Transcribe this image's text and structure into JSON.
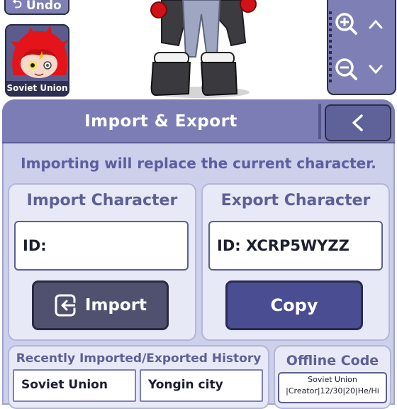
{
  "top": {
    "undo_label": "Undo",
    "character_thumb_label": "Soviet Union"
  },
  "dialog": {
    "title": "Import & Export",
    "back_label": "<",
    "info": "Importing will replace the current character.",
    "import": {
      "title": "Import Character",
      "field_value": "ID:",
      "button_label": "Import"
    },
    "export": {
      "title": "Export Character",
      "field_value": "ID: XCRP5WYZZ",
      "button_label": "Copy"
    },
    "history": {
      "title": "Recently Imported/Exported History",
      "items": [
        "Soviet Union",
        "Yongin city"
      ]
    },
    "offline": {
      "title": "Offline Code",
      "line1": "Soviet Union",
      "line2": "|Creator|12/30|20|He/Hi"
    }
  },
  "colors": {
    "header": "#7b7db4",
    "panel": "#cdd0ea",
    "accent_text": "#5b5ea0",
    "copy_button": "#4a4d92",
    "import_button": "#4f516f"
  }
}
